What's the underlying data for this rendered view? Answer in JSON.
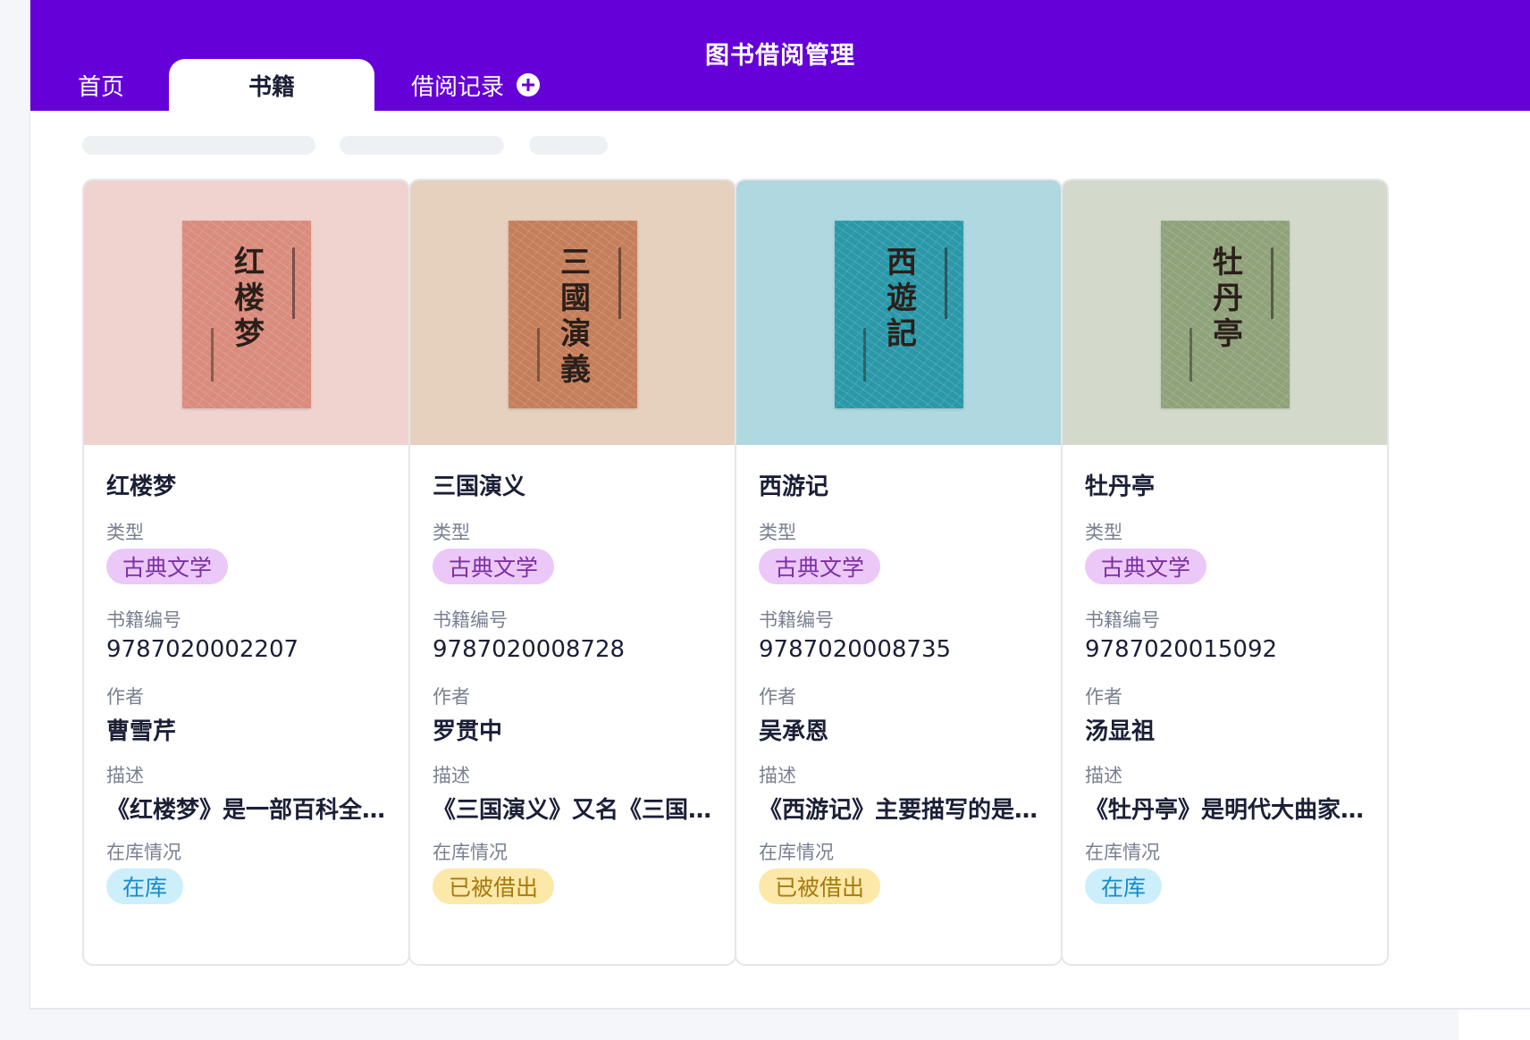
{
  "app": {
    "title": "图书借阅管理"
  },
  "tabs": [
    {
      "label": "首页"
    },
    {
      "label": "书籍"
    },
    {
      "label": "借阅记录"
    }
  ],
  "labels": {
    "type": "类型",
    "isbn": "书籍编号",
    "author": "作者",
    "desc": "描述",
    "stock": "在库情况"
  },
  "books": [
    {
      "name": "红楼梦",
      "cover_title": "红楼梦",
      "type": "古典文学",
      "isbn": "9787020002207",
      "author": "曹雪芹",
      "desc": "《红楼梦》是一部百科全…",
      "stock": "在库",
      "stock_status": "in",
      "cover_bg": "#f0d3cf",
      "cover_color": "#d98b7c"
    },
    {
      "name": "三国演义",
      "cover_title": "三國演義",
      "type": "古典文学",
      "isbn": "9787020008728",
      "author": "罗贯中",
      "desc": "《三国演义》又名《三国…",
      "stock": "已被借出",
      "stock_status": "out",
      "cover_bg": "#e6d0be",
      "cover_color": "#c57e5a"
    },
    {
      "name": "西游记",
      "cover_title": "西遊記",
      "type": "古典文学",
      "isbn": "9787020008735",
      "author": "吴承恩",
      "desc": "《西游记》主要描写的是…",
      "stock": "已被借出",
      "stock_status": "out",
      "cover_bg": "#afd8e0",
      "cover_color": "#2a98a8"
    },
    {
      "name": "牡丹亭",
      "cover_title": "牡丹亭",
      "type": "古典文学",
      "isbn": "9787020015092",
      "author": "汤显祖",
      "desc": "《牡丹亭》是明代大曲家…",
      "stock": "在库",
      "stock_status": "in",
      "cover_bg": "#d4dacb",
      "cover_color": "#8fa27a"
    }
  ]
}
